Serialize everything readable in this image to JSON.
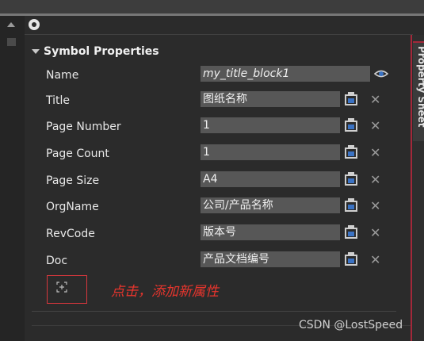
{
  "section": {
    "title": "Symbol Properties"
  },
  "side_tab": {
    "label": "Property Sheet"
  },
  "properties": [
    {
      "label": "Name",
      "value": "my_title_block1"
    },
    {
      "label": "Title",
      "value": "图纸名称"
    },
    {
      "label": "Page Number",
      "value": "1"
    },
    {
      "label": "Page Count",
      "value": "1"
    },
    {
      "label": "Page Size",
      "value": "A4"
    },
    {
      "label": "OrgName",
      "value": "公司/产品名称"
    },
    {
      "label": "RevCode",
      "value": "版本号"
    },
    {
      "label": "Doc",
      "value": "产品文档编号"
    }
  ],
  "hint": "点击，添加新属性",
  "watermark": "CSDN @LostSpeed",
  "icons": {
    "panel": "gear-icon",
    "name_row": "eye-icon",
    "row_actions": [
      "clipboard-icon",
      "close-icon"
    ],
    "add": "add-property-icon"
  },
  "colors": {
    "accent_red": "#e8352d",
    "field_bg": "#575757",
    "panel_bg": "#2b2b2b"
  }
}
